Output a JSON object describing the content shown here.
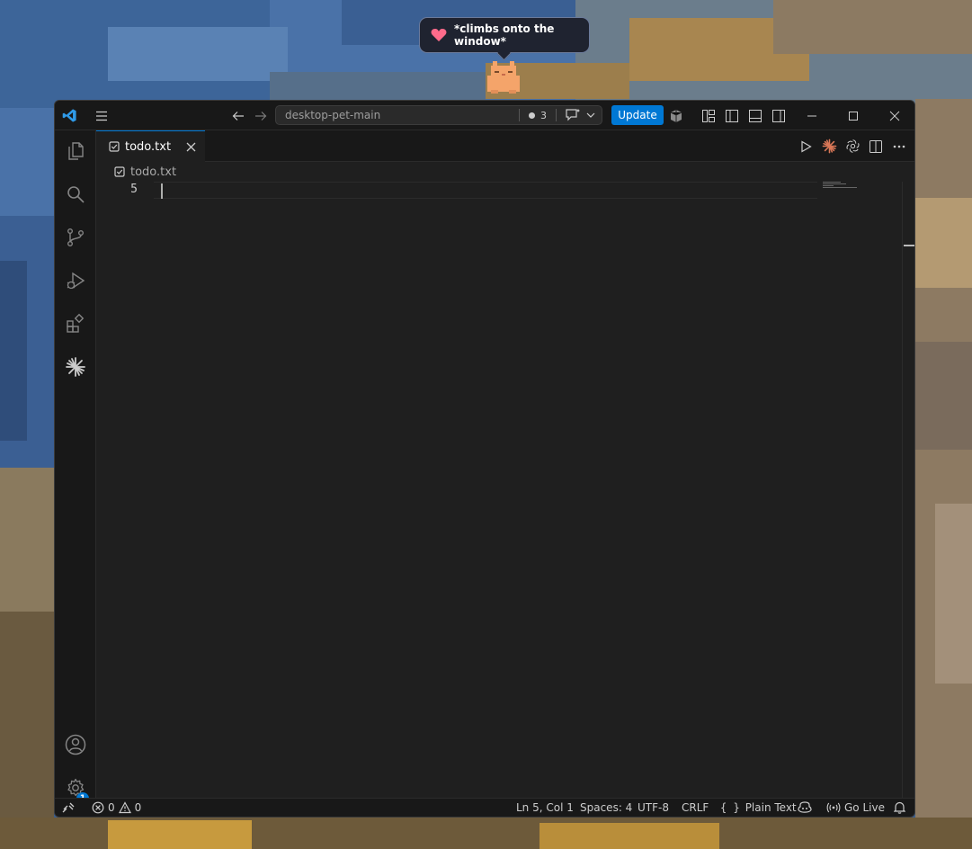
{
  "pet": {
    "message": "*climbs onto the window*",
    "heart_color": "#ff6b8b",
    "cat_color": "#f4a46a"
  },
  "titlebar": {
    "nav_back": "arrow-left-icon",
    "nav_forward": "arrow-right-icon",
    "command_center_title": "desktop-pet-main",
    "changes_count": "3",
    "update_label": "Update"
  },
  "activity_bar": {
    "items": [
      "explorer-icon",
      "search-icon",
      "source-control-icon",
      "run-debug-icon",
      "extensions-icon",
      "claude-icon"
    ],
    "settings_badge": "1"
  },
  "tabs": [
    {
      "label": "todo.txt",
      "active": true
    }
  ],
  "breadcrumb": {
    "file": "todo.txt"
  },
  "editor": {
    "line_number": "5",
    "content": ""
  },
  "statusbar": {
    "errors": "0",
    "warnings": "0",
    "position": "Ln 5, Col 1",
    "indent": "Spaces: 4",
    "encoding": "UTF-8",
    "eol": "CRLF",
    "language": "Plain Text",
    "go_live": "Go Live"
  },
  "colors": {
    "accent": "#0078d4",
    "editor_bg": "#1f1f1f",
    "chrome_bg": "#181818"
  }
}
